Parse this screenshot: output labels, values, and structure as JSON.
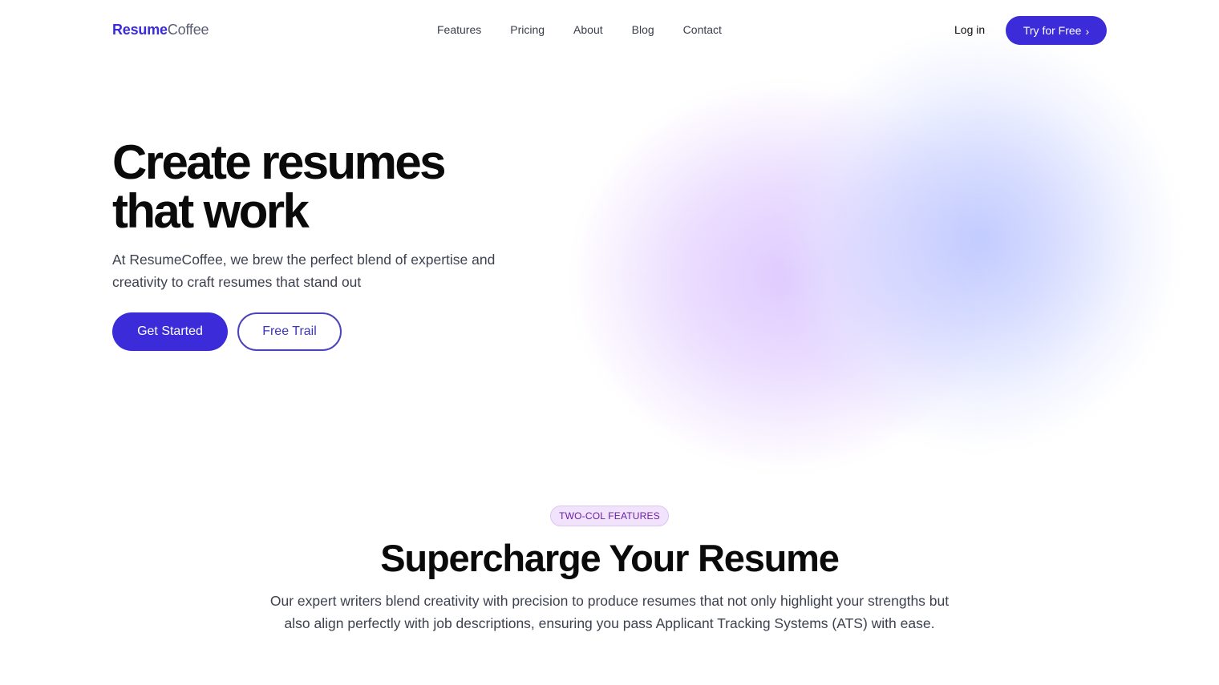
{
  "brand": {
    "logo_bold": "Resume",
    "logo_light": "Coffee",
    "accent_color": "#3b2bd8"
  },
  "nav": {
    "links": [
      {
        "label": "Features"
      },
      {
        "label": "Pricing"
      },
      {
        "label": "About"
      },
      {
        "label": "Blog"
      },
      {
        "label": "Contact"
      }
    ],
    "login_label": "Log in",
    "cta_label": "Try for Free",
    "cta_icon": "chevron-right-icon",
    "cta_glyph": "›"
  },
  "hero": {
    "title_line1": "Create resumes",
    "title_line2": "that work",
    "subtitle": "At ResumeCoffee, we brew the perfect blend of expertise and creativity to craft resumes that stand out",
    "primary_button": "Get Started",
    "secondary_button": "Free Trail"
  },
  "features": {
    "badge": "TWO-COL FEATURES",
    "title": "Supercharge Your Resume",
    "description": "Our expert writers blend creativity with precision to produce resumes that not only highlight your strengths but also align perfectly with job descriptions, ensuring you pass Applicant Tracking Systems (ATS) with ease."
  }
}
